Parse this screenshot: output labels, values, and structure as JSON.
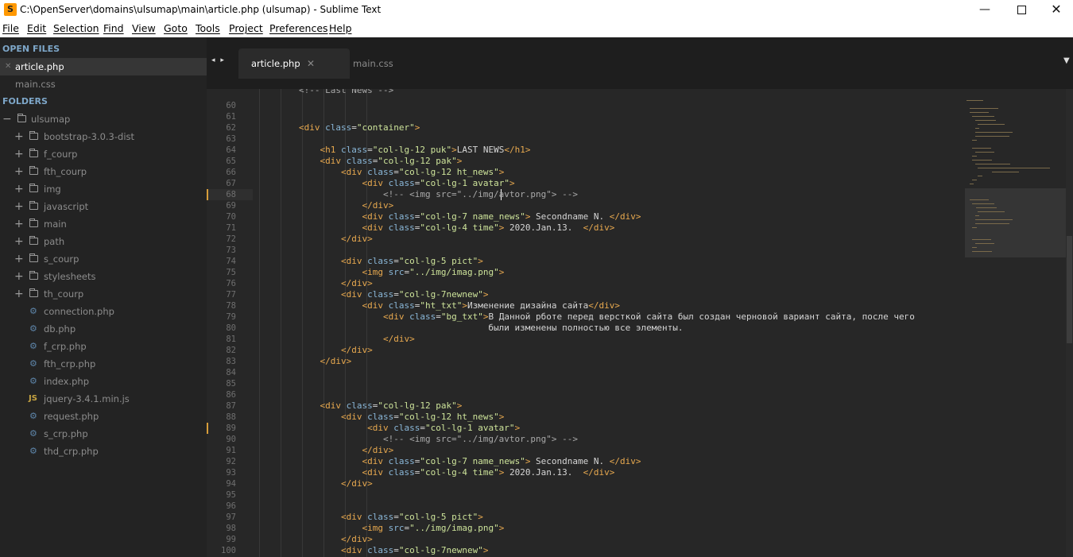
{
  "window": {
    "title": "C:\\OpenServer\\domains\\ulsumap\\main\\article.php (ulsumap) - Sublime Text",
    "app_icon": "S",
    "minimize": "—",
    "close": "✕"
  },
  "menu": [
    "File",
    "Edit",
    "Selection",
    "Find",
    "View",
    "Goto",
    "Tools",
    "Project",
    "Preferences",
    "Help"
  ],
  "sidebar": {
    "open_files_heading": "OPEN FILES",
    "open_files": [
      {
        "label": "article.php",
        "active": true
      },
      {
        "label": "main.css",
        "active": false
      }
    ],
    "folders_heading": "FOLDERS",
    "root": "ulsumap",
    "folders": [
      "bootstrap-3.0.3-dist",
      "f_courp",
      "fth_courp",
      "img",
      "javascript",
      "main",
      "path",
      "s_courp",
      "stylesheets",
      "th_courp"
    ],
    "files": [
      {
        "label": "connection.php",
        "icon": "gear-icon"
      },
      {
        "label": "db.php",
        "icon": "gear-icon"
      },
      {
        "label": "f_crp.php",
        "icon": "gear-icon"
      },
      {
        "label": "fth_crp.php",
        "icon": "gear-icon"
      },
      {
        "label": "index.php",
        "icon": "gear-icon"
      },
      {
        "label": "jquery-3.4.1.min.js",
        "icon": "js-icon"
      },
      {
        "label": "request.php",
        "icon": "gear-icon"
      },
      {
        "label": "s_crp.php",
        "icon": "gear-icon"
      },
      {
        "label": "thd_crp.php",
        "icon": "gear-icon"
      }
    ],
    "js_icon_text": "JS"
  },
  "tabs": {
    "nav": "◂ ▸",
    "items": [
      {
        "label": "article.php",
        "active": true,
        "close": "✕"
      },
      {
        "label": "main.css",
        "active": false
      }
    ],
    "dropdown": "▼"
  },
  "editor": {
    "first_partial": "<!-- Last News -->",
    "line_numbers": [
      "60",
      "61",
      "62",
      "63",
      "64",
      "65",
      "66",
      "67",
      "68",
      "69",
      "70",
      "71",
      "72",
      "73",
      "74",
      "75",
      "76",
      "77",
      "78",
      "79",
      "80",
      "81",
      "82",
      "83",
      "84",
      "85",
      "86",
      "87",
      "88",
      "89",
      "90",
      "91",
      "92",
      "93",
      "94",
      "95",
      "96",
      "97",
      "98",
      "99",
      "100"
    ],
    "modified_lines": [
      "68",
      "89"
    ],
    "lines": [
      "",
      "",
      "<div class=\"container\">",
      "",
      "    <h1 class=\"col-lg-12 puk\">LAST NEWS</h1>",
      "    <div class=\"col-lg-12 pak\">",
      "        <div class=\"col-lg-12 ht_news\">",
      "            <div class=\"col-lg-1 avatar\">",
      "                <!-- <img src=\"../img/avtor.png\"> -->",
      "            </div>",
      "            <div class=\"col-lg-7 name_news\"> Secondname N. </div>",
      "            <div class=\"col-lg-4 time\"> 2020.Jan.13.  </div>",
      "        </div>",
      "",
      "        <div class=\"col-lg-5 pict\">",
      "            <img src=\"../img/imag.png\">",
      "        </div>",
      "        <div class=\"col-lg-7newnew\">",
      "            <div class=\"ht_txt\">Изменение дизайна сайта</div>",
      "                <div class=\"bg_txt\">В Данной рботе перед версткой сайта был создан черновой вариант сайта, после чего",
      "                                    были изменены полностью все элементы.",
      "                </div>",
      "        </div>",
      "    </div>",
      "",
      "",
      "",
      "    <div class=\"col-lg-12 pak\">",
      "        <div class=\"col-lg-12 ht_news\">",
      "             <div class=\"col-lg-1 avatar\">",
      "                <!-- <img src=\"../img/avtor.png\"> -->",
      "            </div>",
      "            <div class=\"col-lg-7 name_news\"> Secondname N. </div>",
      "            <div class=\"col-lg-4 time\"> 2020.Jan.13.  </div>",
      "        </div>",
      "",
      "",
      "        <div class=\"col-lg-5 pict\">",
      "            <img src=\"../img/imag.png\">",
      "        </div>",
      "        <div class=\"col-lg-7newnew\">"
    ]
  }
}
